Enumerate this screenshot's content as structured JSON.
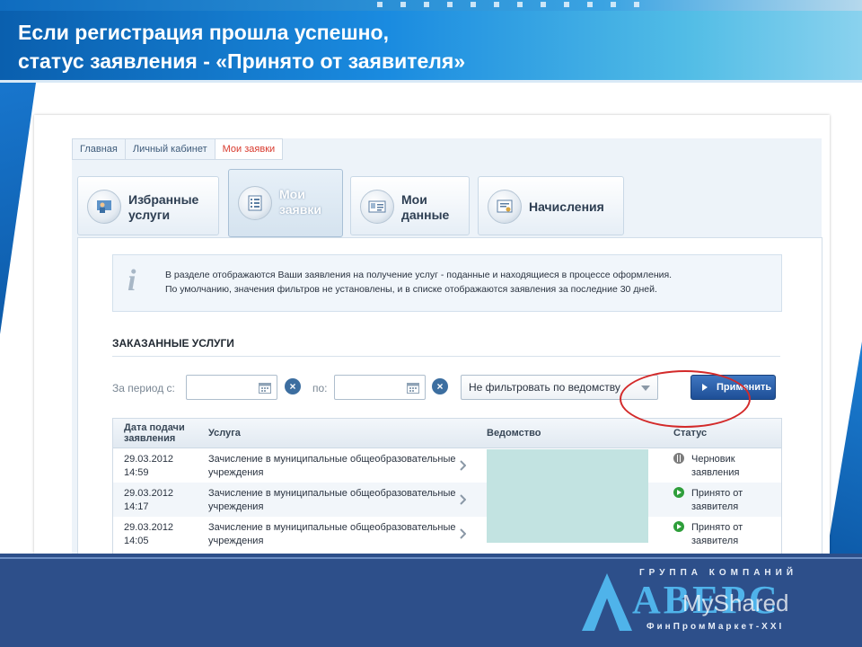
{
  "slide": {
    "title_line1": "Если регистрация прошла успешно,",
    "title_line2": "статус заявления - «Принято от заявителя»"
  },
  "breadcrumb": [
    "Главная",
    "Личный кабинет",
    "Мои заявки"
  ],
  "tabs": [
    {
      "line1": "Избранные",
      "line2": "услуги",
      "icon": "user-screen-icon",
      "active": false
    },
    {
      "line1": "Мои",
      "line2": "заявки",
      "icon": "checklist-icon",
      "active": true
    },
    {
      "line1": "Мои",
      "line2": "данные",
      "icon": "id-card-icon",
      "active": false
    },
    {
      "line1": "Начисления",
      "line2": "",
      "icon": "certificate-icon",
      "active": false
    }
  ],
  "info": {
    "line1": "В разделе отображаются Ваши заявления на получение услуг - поданные и находящиеся в процессе оформления.",
    "line2": "По умолчанию, значения фильтров не установлены, и в списке отображаются заявления за последние 30 дней."
  },
  "section_title": "ЗАКАЗАННЫЕ УСЛУГИ",
  "filters": {
    "period_from_label": "За период с:",
    "period_to_label": "по:",
    "from_value": "",
    "to_value": "",
    "department_select": "Не фильтровать по ведомству",
    "apply_label": "Применить"
  },
  "table": {
    "headers": {
      "date_line1": "Дата подачи",
      "date_line2": "заявления",
      "service": "Услуга",
      "department": "Ведомство",
      "status": "Статус"
    },
    "rows": [
      {
        "date": "29.03.2012",
        "time": "14:59",
        "service_line1": "Зачисление в муниципальные общеобразовательные",
        "service_line2": "учреждения",
        "status_line1": "Черновик",
        "status_line2": "заявления",
        "status_type": "draft"
      },
      {
        "date": "29.03.2012",
        "time": "14:17",
        "service_line1": "Зачисление в муниципальные общеобразовательные",
        "service_line2": "учреждения",
        "status_line1": "Принято от",
        "status_line2": "заявителя",
        "status_type": "accepted"
      },
      {
        "date": "29.03.2012",
        "time": "14:05",
        "service_line1": "Зачисление в муниципальные общеобразовательные",
        "service_line2": "учреждения",
        "status_line1": "Принято от",
        "status_line2": "заявителя",
        "status_type": "accepted"
      }
    ]
  },
  "logo": {
    "group": "ГРУППА КОМПАНИЙ",
    "brand": "АВЕРС",
    "sub": "ФинПромМаркет-XXI"
  },
  "watermark": "MyShared",
  "colors": {
    "accent_blue": "#1a8be0",
    "highlight_red": "#d32a2a",
    "status_draft": "#7c7c7c",
    "status_accepted": "#2e9e3a",
    "redaction": "#c2e3e1"
  }
}
